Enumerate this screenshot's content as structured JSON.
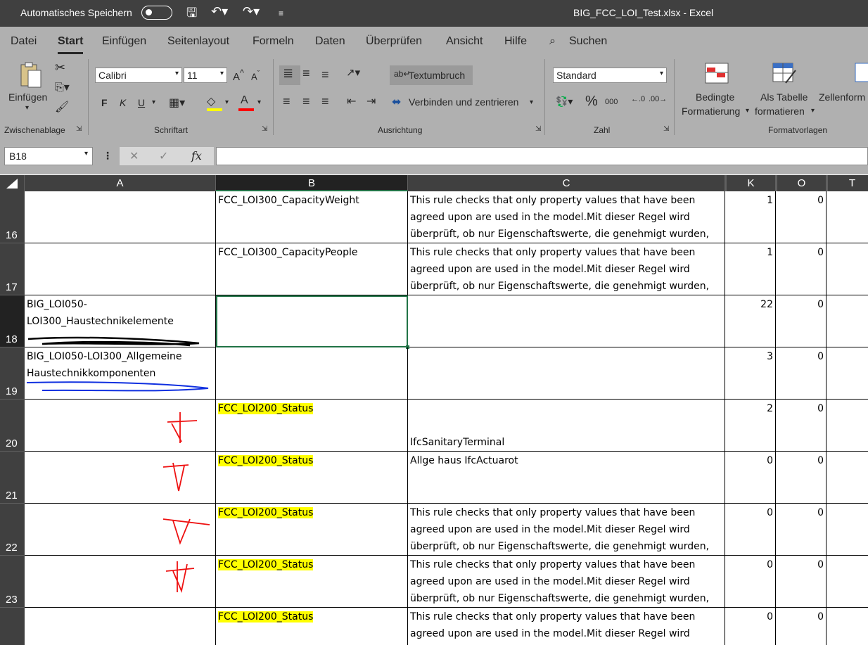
{
  "titlebar": {
    "autosave_label": "Automatisches Speichern",
    "document_title": "BIG_FCC_LOI_Test.xlsx  -  Excel"
  },
  "tabs": [
    "Datei",
    "Start",
    "Einfügen",
    "Seitenlayout",
    "Formeln",
    "Daten",
    "Überprüfen",
    "Ansicht",
    "Hilfe"
  ],
  "active_tab": "Start",
  "search_label": "Suchen",
  "ribbon": {
    "clipboard": {
      "paste_label": "Einfügen",
      "group_label": "Zwischenablage"
    },
    "font": {
      "font_name": "Calibri",
      "font_size": "11",
      "bold": "F",
      "italic": "K",
      "underline": "U",
      "grow": "A",
      "shrink": "A",
      "group_label": "Schriftart",
      "fill_color": "#ffff00",
      "font_color": "#ff0000"
    },
    "alignment": {
      "wrap_label": "Textumbruch",
      "merge_label": "Verbinden und zentrieren",
      "group_label": "Ausrichtung"
    },
    "number": {
      "format": "Standard",
      "percent": "%",
      "thousands": "000",
      "group_label": "Zahl"
    },
    "styles": {
      "conditional_1": "Bedingte",
      "conditional_2": "Formatierung",
      "table_1": "Als Tabelle",
      "table_2": "formatieren",
      "cell_styles": "Zellenform",
      "group_label": "Formatvorlagen"
    }
  },
  "formula_bar": {
    "name_box": "B18",
    "fx": "fx",
    "content": ""
  },
  "columns": [
    "A",
    "B",
    "C",
    "K",
    "O",
    "T"
  ],
  "selected_column": "B",
  "selected_row": "18",
  "rows": [
    {
      "num": "16",
      "a": "",
      "b": "FCC_LOI300_CapacityWeight",
      "c": "This rule checks that only property values that have been agreed upon are used in the model.Mit dieser Regel wird überprüft, ob nur Eigenschaftswerte, die genehmigt wurden,",
      "k": "1",
      "o": "0"
    },
    {
      "num": "17",
      "a": "",
      "b": "FCC_LOI300_CapacityPeople",
      "c": "This rule checks that only property values that have been agreed upon are used in the model.Mit dieser Regel wird überprüft, ob nur Eigenschaftswerte, die genehmigt wurden,",
      "k": "1",
      "o": "0"
    },
    {
      "num": "18",
      "a": "BIG_LOI050-LOI300_Haustechnikelemente",
      "b": "",
      "c": "",
      "k": "22",
      "o": "0"
    },
    {
      "num": "19",
      "a": "BIG_LOI050-LOI300_Allgemeine Haustechnikkomponenten",
      "b": "",
      "c": "",
      "k": "3",
      "o": "0"
    },
    {
      "num": "20",
      "a": "",
      "b": "FCC_LOI200_Status",
      "c": "IfcSanitaryTerminal",
      "k": "2",
      "o": "0"
    },
    {
      "num": "21",
      "a": "",
      "b": "FCC_LOI200_Status",
      "c": "Allge haus IfcActuarot",
      "k": "0",
      "o": "0"
    },
    {
      "num": "22",
      "a": "",
      "b": "FCC_LOI200_Status",
      "c": "This rule checks that only property values that have been agreed upon are used in the model.Mit dieser Regel wird überprüft, ob nur Eigenschaftswerte, die genehmigt wurden,",
      "k": "0",
      "o": "0"
    },
    {
      "num": "23",
      "a": "",
      "b": "FCC_LOI200_Status",
      "c": "This rule checks that only property values that have been agreed upon are used in the model.Mit dieser Regel wird überprüft, ob nur Eigenschaftswerte, die genehmigt wurden,",
      "k": "0",
      "o": "0"
    },
    {
      "num": "",
      "a": "",
      "b": "FCC_LOI200_Status",
      "c": "This rule checks that only property values that have been agreed upon are used in the model.Mit dieser Regel wird",
      "k": "0",
      "o": "0"
    }
  ],
  "annotation_colors": {
    "black_scribble": "#000000",
    "blue_underline": "#1030e0",
    "red_marks": "#ee1111",
    "highlight": "#ffff00"
  }
}
